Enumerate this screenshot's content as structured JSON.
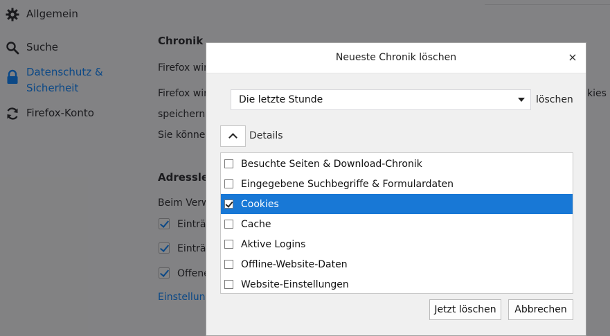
{
  "sidebar": {
    "items": [
      {
        "label": "Allgemein",
        "icon": "gear-icon"
      },
      {
        "label": "Suche",
        "icon": "search-icon"
      },
      {
        "label": "Datenschutz &",
        "label2": "Sicherheit",
        "icon": "lock-icon",
        "active": true
      },
      {
        "label": "Firefox-Konto",
        "icon": "sync-icon"
      }
    ]
  },
  "main": {
    "chronik_heading": "Chronik",
    "line1": "Firefox wir",
    "line2": "Firefox wir",
    "line2_suffix": "kies",
    "line3": "speichern.",
    "line4": "Sie können",
    "adress_heading": "Adressle",
    "beim": "Beim Verw",
    "check1": "Einträ",
    "check2": "Einträ",
    "check3": "Offene",
    "settings_link": "Einstellung"
  },
  "dialog": {
    "title": "Neueste Chronik löschen",
    "close_symbol": "×",
    "range_value": "Die letzte Stunde",
    "range_suffix": "löschen",
    "details_label": "Details",
    "items": [
      {
        "label": "Besuchte Seiten & Download-Chronik",
        "checked": false
      },
      {
        "label": "Eingegebene Suchbegriffe & Formulardaten",
        "checked": false
      },
      {
        "label": "Cookies",
        "checked": true
      },
      {
        "label": "Cache",
        "checked": false
      },
      {
        "label": "Aktive Logins",
        "checked": false
      },
      {
        "label": "Offline-Website-Daten",
        "checked": false
      },
      {
        "label": "Website-Einstellungen",
        "checked": false
      }
    ],
    "clear_button": "Jetzt löschen",
    "cancel_button": "Abbrechen"
  },
  "colors": {
    "accent": "#0a84ff",
    "selection": "#1878d6"
  }
}
